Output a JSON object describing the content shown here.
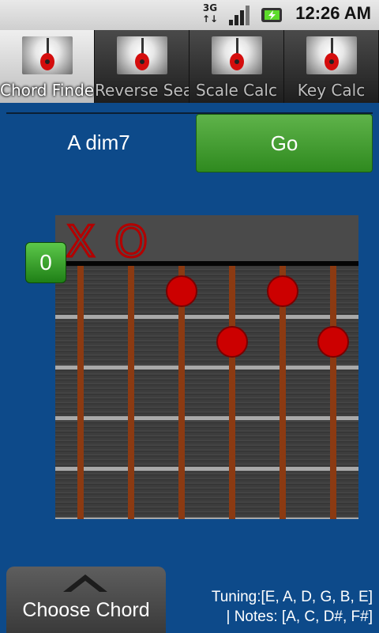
{
  "status_bar": {
    "network": "3G",
    "time": "12:26 AM"
  },
  "tabs": [
    {
      "label": "Chord Finder",
      "active": true
    },
    {
      "label": "Reverse Sear",
      "active": false
    },
    {
      "label": "Scale Calc",
      "active": false
    },
    {
      "label": "Key Calc",
      "active": false
    }
  ],
  "chord": {
    "name": "A dim7"
  },
  "go_button": {
    "label": "Go"
  },
  "fretboard": {
    "start_fret": "0",
    "string_markers": [
      "X",
      "O",
      "",
      "",
      "",
      ""
    ],
    "fingerings": [
      {
        "string": 3,
        "fret": 1
      },
      {
        "string": 5,
        "fret": 1
      },
      {
        "string": 4,
        "fret": 2
      },
      {
        "string": 6,
        "fret": 2
      }
    ],
    "string_count": 6,
    "fret_count": 5
  },
  "choose_chord": {
    "label": "Choose Chord"
  },
  "info": {
    "tuning": "Tuning:[E, A, D, G, B, E]",
    "notes": "|  Notes: [A, C, D#, F#]"
  },
  "colors": {
    "background": "#0d4a8a",
    "go": "#3f9c2e",
    "dot": "#cc0000"
  }
}
